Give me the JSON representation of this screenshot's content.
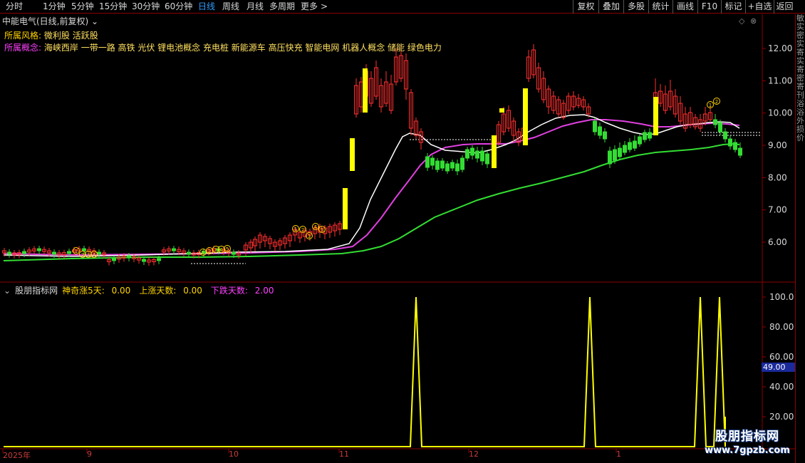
{
  "toolbar": {
    "timeframes": [
      "分时",
      "1分钟",
      "5分钟",
      "15分钟",
      "30分钟",
      "60分钟",
      "日线",
      "周线",
      "月线",
      "多周期",
      "更多"
    ],
    "active_timeframe": "日线",
    "more_arrow": ">",
    "right_buttons": [
      "复权",
      "叠加",
      "多股",
      "统计",
      "画线",
      "F10",
      "标记",
      "+自选",
      "返回"
    ]
  },
  "stock": {
    "title": "中能电气(日线,前复权)",
    "title_arrow": "⌄"
  },
  "info": {
    "style_label": "所属风格:",
    "style_value": "微利股 活跃股",
    "concept_label": "所属概念:",
    "concept_value": "海峡西岸 一带一路 高铁 光伏 锂电池概念 充电桩 新能源车 高压快充 智能电网 机器人概念 储能 绿色电力"
  },
  "indicator": {
    "name": "股朋指标网",
    "line1_label": "神奇涨5天:",
    "line1_value": "0.00",
    "line2_label": "上涨天数:",
    "line2_value": "0.00",
    "line3_label": "下跌天数:",
    "line3_value": "2.00",
    "current_tag": "49.00"
  },
  "price_axis": [
    "12.00",
    "11.00",
    "10.00",
    "9.00",
    "8.00",
    "7.00",
    "6.00"
  ],
  "indicator_axis": [
    "100.0",
    "80.00",
    "60.00",
    "40.00",
    "20.00"
  ],
  "x_axis": [
    "2025年",
    "9",
    "10",
    "11",
    "12",
    "1"
  ],
  "right_strip_text": "敏实密实寄实寄密寄刊浴浴外损价",
  "watermark": {
    "name": "股朋指标网",
    "url": "www.7gpzb.com"
  },
  "colors": {
    "up": "#ff3030",
    "down": "#33dd33",
    "ma_white": "#ffffff",
    "ma_magenta": "#e040e0",
    "ma_green": "#33dd33",
    "signal": "#ffff00",
    "axis_red": "#8b0000"
  }
}
